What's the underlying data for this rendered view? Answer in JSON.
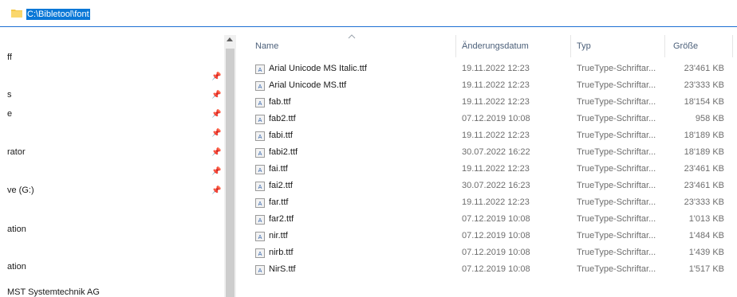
{
  "address": {
    "path": "C:\\Bibletool\\font"
  },
  "nav": {
    "items": [
      {
        "label": "ff"
      },
      {
        "label": "s"
      },
      {
        "label": "e"
      },
      {
        "label": "rator"
      },
      {
        "label": "ve (G:)"
      },
      {
        "label": "ation"
      },
      {
        "label": "ation"
      },
      {
        "label": "MST Systemtechnik AG"
      }
    ]
  },
  "columns": {
    "name": "Name",
    "date": "Änderungsdatum",
    "type": "Typ",
    "size": "Größe"
  },
  "files": [
    {
      "name": "Arial Unicode MS Italic.ttf",
      "date": "19.11.2022 12:23",
      "type": "TrueType-Schriftar...",
      "size": "23'461 KB"
    },
    {
      "name": "Arial Unicode MS.ttf",
      "date": "19.11.2022 12:23",
      "type": "TrueType-Schriftar...",
      "size": "23'333 KB"
    },
    {
      "name": "fab.ttf",
      "date": "19.11.2022 12:23",
      "type": "TrueType-Schriftar...",
      "size": "18'154 KB"
    },
    {
      "name": "fab2.ttf",
      "date": "07.12.2019 10:08",
      "type": "TrueType-Schriftar...",
      "size": "958 KB"
    },
    {
      "name": "fabi.ttf",
      "date": "19.11.2022 12:23",
      "type": "TrueType-Schriftar...",
      "size": "18'189 KB"
    },
    {
      "name": "fabi2.ttf",
      "date": "30.07.2022 16:22",
      "type": "TrueType-Schriftar...",
      "size": "18'189 KB"
    },
    {
      "name": "fai.ttf",
      "date": "19.11.2022 12:23",
      "type": "TrueType-Schriftar...",
      "size": "23'461 KB"
    },
    {
      "name": "fai2.ttf",
      "date": "30.07.2022 16:23",
      "type": "TrueType-Schriftar...",
      "size": "23'461 KB"
    },
    {
      "name": "far.ttf",
      "date": "19.11.2022 12:23",
      "type": "TrueType-Schriftar...",
      "size": "23'333 KB"
    },
    {
      "name": "far2.ttf",
      "date": "07.12.2019 10:08",
      "type": "TrueType-Schriftar...",
      "size": "1'013 KB"
    },
    {
      "name": "nir.ttf",
      "date": "07.12.2019 10:08",
      "type": "TrueType-Schriftar...",
      "size": "1'484 KB"
    },
    {
      "name": "nirb.ttf",
      "date": "07.12.2019 10:08",
      "type": "TrueType-Schriftar...",
      "size": "1'439 KB"
    },
    {
      "name": "NirS.ttf",
      "date": "07.12.2019 10:08",
      "type": "TrueType-Schriftar...",
      "size": "1'517 KB"
    }
  ],
  "icons": {
    "folder": "folder-icon",
    "pin": "pin-icon",
    "file": "font-file-icon"
  },
  "colors": {
    "selection": "#0a78d7",
    "header_text": "#4c607a",
    "secondary_text": "#6d6d6d"
  }
}
